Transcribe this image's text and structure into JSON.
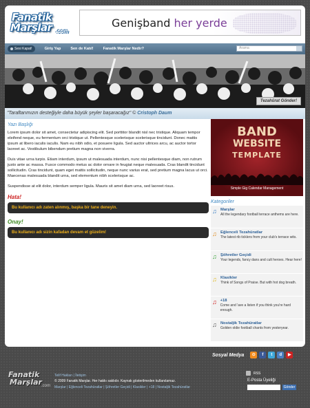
{
  "logo": {
    "line1": "Fanatik",
    "line2": "Marşlar",
    "suffix": ".com"
  },
  "banner": {
    "text1": "Genişband ",
    "text2": "her yerde"
  },
  "nav": {
    "sound_label": "Sesi Kapat!",
    "links": [
      "Giriş Yap",
      "Sen de Katıl!",
      "Fanatik Marşlar Nedir?"
    ],
    "search_placeholder": "Arama"
  },
  "hero": {
    "button": "Tezahürat Gönder!"
  },
  "quote": {
    "text": "\"Taraftarımızın desteğiyle daha büyük şeyler başaracağız\" © ",
    "author": "Cristoph Daum"
  },
  "main": {
    "heading": "Yazı Başlığı",
    "paragraphs": [
      "Lorem ipsum dolor sit amet, consectetur adipiscing elit. Sed porttitor blandit nisl nec tristique. Aliquam tempor eleifend neque, eu fermentum orci tristique ut. Pellentesque scelerisque scelerisque tincidunt. Donec mattis ipsum at libero iaculis iaculis. Nam eu nibh odio, et posuere ligula. Sed auctor ultrices arcu, ac auctor tortor laoreet ac. Vestibulum bibendum pretium magna non viverra.",
      "Duis vitae urna turpis. Etiam interdum, ipsum ut malesuada interdum, nunc nisi pellentesque diam, non rutrum justo ante ac massa. Fusce commodo metus ac dolor ornare in feugiat neque malesuada. Cras blandit tincidunt sollicitudin. Cras tincidunt, quam eget mattis sollicitudin, neque nunc varius erat, sed pretium magna lacus ut orci. Maecenas malesuada blandit urna, sed elementum nibh scelerisque ac.",
      "Suspendisse at elit dolor, interdum semper ligula. Mauris sit amet diam urna, sed laoreet risus."
    ],
    "error_title": "Hata!",
    "error_message": "Bu kullanıcı adı zaten alınmış, başka bir tane deneyin.",
    "ok_title": "Onay!",
    "ok_message": "Bu kullanıcı adı sizin kafadan devam et güzelim!"
  },
  "ad": {
    "line1": "BAND",
    "line2": "WEBSITE",
    "line3": "TEMPLATE",
    "line4": "Simple Gig Calendar Management"
  },
  "sidebar": {
    "heading": "Kategoriler",
    "items": [
      {
        "title": "Marşlar",
        "desc": "All the legendary football terrace anthems are here.",
        "icon_color": "#3a7fc4"
      },
      {
        "title": "Eğlenceli Tezahüratlar",
        "desc": "The latest rib ticklers from your club's terrace wits.",
        "icon_color": "#e08a1c"
      },
      {
        "title": "Şöhretler Geçidi",
        "desc": "Your legends, fancy dans and cult heroes. Hear here!",
        "icon_color": "#3aa43a"
      },
      {
        "title": "Klasikler",
        "desc": "Think of Songs of Praise. But with hot dog breath.",
        "icon_color": "#e0b81c"
      },
      {
        "title": "+18",
        "desc": "Come and 'ave a listen if you think you're hard enough.",
        "icon_color": "#d02020"
      },
      {
        "title": "Nostaljik Tezahüratlar",
        "desc": "Golden oldie football chants from yesteryear.",
        "icon_color": "#555555"
      }
    ]
  },
  "social": {
    "label": "Sosyal Medya",
    "icons": [
      {
        "name": "rss-icon",
        "glyph": "⊙",
        "color": "#f28c1e"
      },
      {
        "name": "facebook-icon",
        "glyph": "f",
        "color": "#3b5998"
      },
      {
        "name": "twitter-icon",
        "glyph": "t",
        "color": "#3ea7d8"
      },
      {
        "name": "delicious-icon",
        "glyph": "d",
        "color": "#4a7fc1"
      },
      {
        "name": "youtube-icon",
        "glyph": "▶",
        "color": "#cc2222"
      }
    ]
  },
  "footer": {
    "links": "Telif Hakları | İletişim",
    "copyright": "© 2009 Fanatik Marşlar. Her hakkı saklıdır. Kaynak gösterilmeden kullanılamaz.",
    "categories": "Marşlar | Eğlenceli Tezahüratlar | Şöhretler Geçidi | Klasikler | +18 | Nostaljik Tezahüratlar",
    "rss": "RSS",
    "mail_title": "E-Posta Üyeliği",
    "mail_button": "Gönder"
  }
}
